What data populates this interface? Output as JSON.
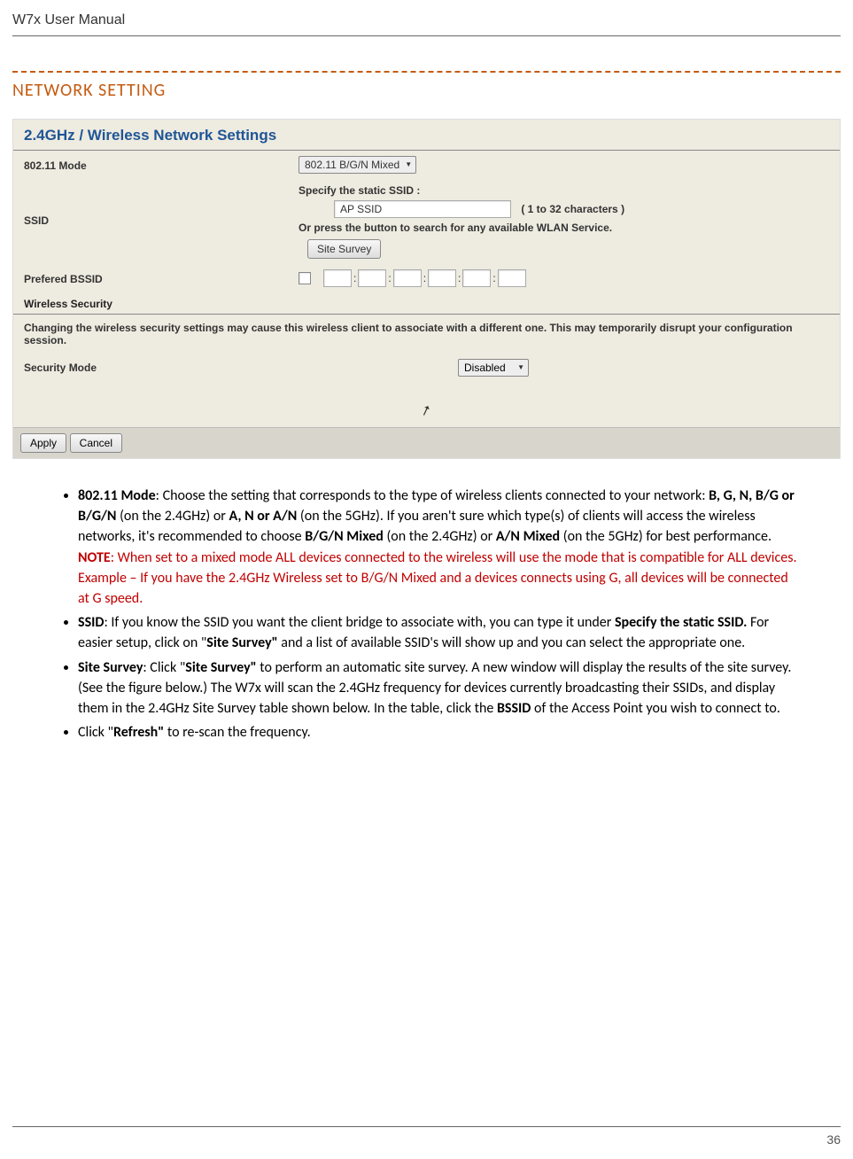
{
  "header": {
    "title": "W7x  User Manual"
  },
  "section": {
    "heading": "NETWORK SETTING"
  },
  "router": {
    "title": "2.4GHz / Wireless Network Settings",
    "mode": {
      "label": "802.11 Mode",
      "value": "802.11 B/G/N Mixed"
    },
    "ssid": {
      "label": "SSID",
      "specify": "Specify the static SSID  :",
      "value": "AP SSID",
      "hint": "( 1 to 32 characters )",
      "or_text": "Or press the button to search for any available WLAN Service.",
      "button": "Site Survey"
    },
    "bssid": {
      "label": "Prefered BSSID"
    },
    "security_section": "Wireless Security",
    "security_warning": "Changing the wireless security settings may cause this wireless client to associate with a different one. This may temporarily disrupt your configuration session.",
    "security_mode": {
      "label": "Security Mode",
      "value": "Disabled"
    },
    "buttons": {
      "apply": "Apply",
      "cancel": "Cancel"
    }
  },
  "bullets": {
    "b1": {
      "t1": "802.11 Mode",
      "t2": ": Choose the setting that corresponds to the type of wireless clients connected to your network: ",
      "t3": "B, G, N, B/G or B/G/N",
      "t4": " (on the 2.4GHz) or ",
      "t5": "A, N or A/N",
      "t6": " (on the 5GHz).   If you aren't sure which type(s) of clients will access the wireless networks, it's recommended to choose ",
      "t7": "B/G/N Mixed",
      "t8": " (on the 2.4GHz) or ",
      "t9": "A/N Mixed",
      "t10": " (on the 5GHz) for best performance.",
      "note_label": "NOTE",
      "note_text": ": When set to a mixed mode ALL devices connected to the wireless will use the mode that is compatible for ALL devices.  Example – If you have the 2.4GHz Wireless set to B/G/N Mixed and a devices connects using G, all devices will be connected at G speed."
    },
    "b2": {
      "t1": "SSID",
      "t2": ": If you know the SSID you want the client bridge to associate with, you can type it under ",
      "t3": "Specify the static SSID.",
      "t4": " For easier setup, click on \"",
      "t5": "Site Survey\"",
      "t6": " and a list of available SSID's will show up and you can select the appropriate one."
    },
    "b3": {
      "t1": "Site Survey",
      "t2": ": Click \"",
      "t3": "Site Survey\"",
      "t4": " to perform an automatic site survey. A new window will display the results of the site survey. (See the figure below.) The W7x will scan the 2.4GHz frequency for devices currently broadcasting their SSIDs, and display them in the 2.4GHz Site Survey table shown below. In the table, click the ",
      "t5": "BSSID",
      "t6": " of the Access Point you wish to connect to."
    },
    "b4": {
      "t1": "Click \"",
      "t2": "Refresh\"",
      "t3": " to re-scan the frequency."
    }
  },
  "footer": {
    "page": "36"
  }
}
